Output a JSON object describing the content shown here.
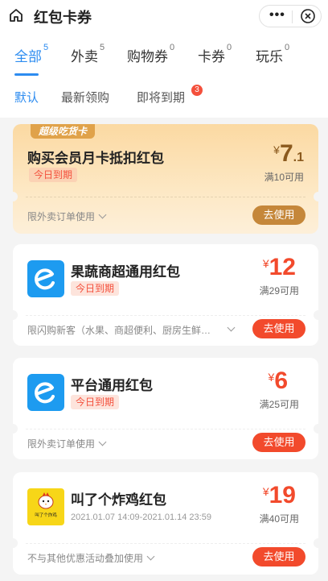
{
  "header": {
    "title": "红包卡券",
    "more_label": "•••"
  },
  "category_tabs": [
    {
      "label": "全部",
      "count": "5",
      "active": true
    },
    {
      "label": "外卖",
      "count": "5"
    },
    {
      "label": "购物券",
      "count": "0"
    },
    {
      "label": "卡券",
      "count": "0"
    },
    {
      "label": "玩乐",
      "count": "0"
    }
  ],
  "sort_tabs": [
    {
      "label": "默认",
      "active": true
    },
    {
      "label": "最新领购"
    },
    {
      "label": "即将到期",
      "badge": "3"
    }
  ],
  "cards": [
    {
      "ribbon": "超级吃货卡",
      "title": "购买会员月卡抵扣红包",
      "tag": "今日到期",
      "currency": "¥",
      "amount_int": "7",
      "amount_dec": ".1",
      "min_spend": "满10可用",
      "limit": "限外卖订单使用",
      "button": "去使用"
    },
    {
      "title": "果蔬商超通用红包",
      "tag": "今日到期",
      "currency": "¥",
      "amount_int": "12",
      "min_spend": "满29可用",
      "limit": "限闪购新客（水果、商超便利、厨房生鲜…",
      "button": "去使用"
    },
    {
      "title": "平台通用红包",
      "tag": "今日到期",
      "currency": "¥",
      "amount_int": "6",
      "min_spend": "满25可用",
      "limit": "限外卖订单使用",
      "button": "去使用"
    },
    {
      "title": "叫了个炸鸡红包",
      "date_range": "2021.01.07 14:09-2021.01.14 23:59",
      "currency": "¥",
      "amount_int": "19",
      "min_spend": "满40可用",
      "limit": "不与其他优惠活动叠加使用",
      "button": "去使用",
      "logo_text": "叫了个炸鸡"
    }
  ],
  "colors": {
    "accent": "#2d8cf0",
    "red": "#f24a2c",
    "gold_button": "#c5873a",
    "amount_gold": "#8b5a1e"
  },
  "icons": [
    "home-icon",
    "more-icon",
    "close-icon",
    "eleme-logo-icon",
    "chicken-logo-icon",
    "chevron-down-icon"
  ]
}
